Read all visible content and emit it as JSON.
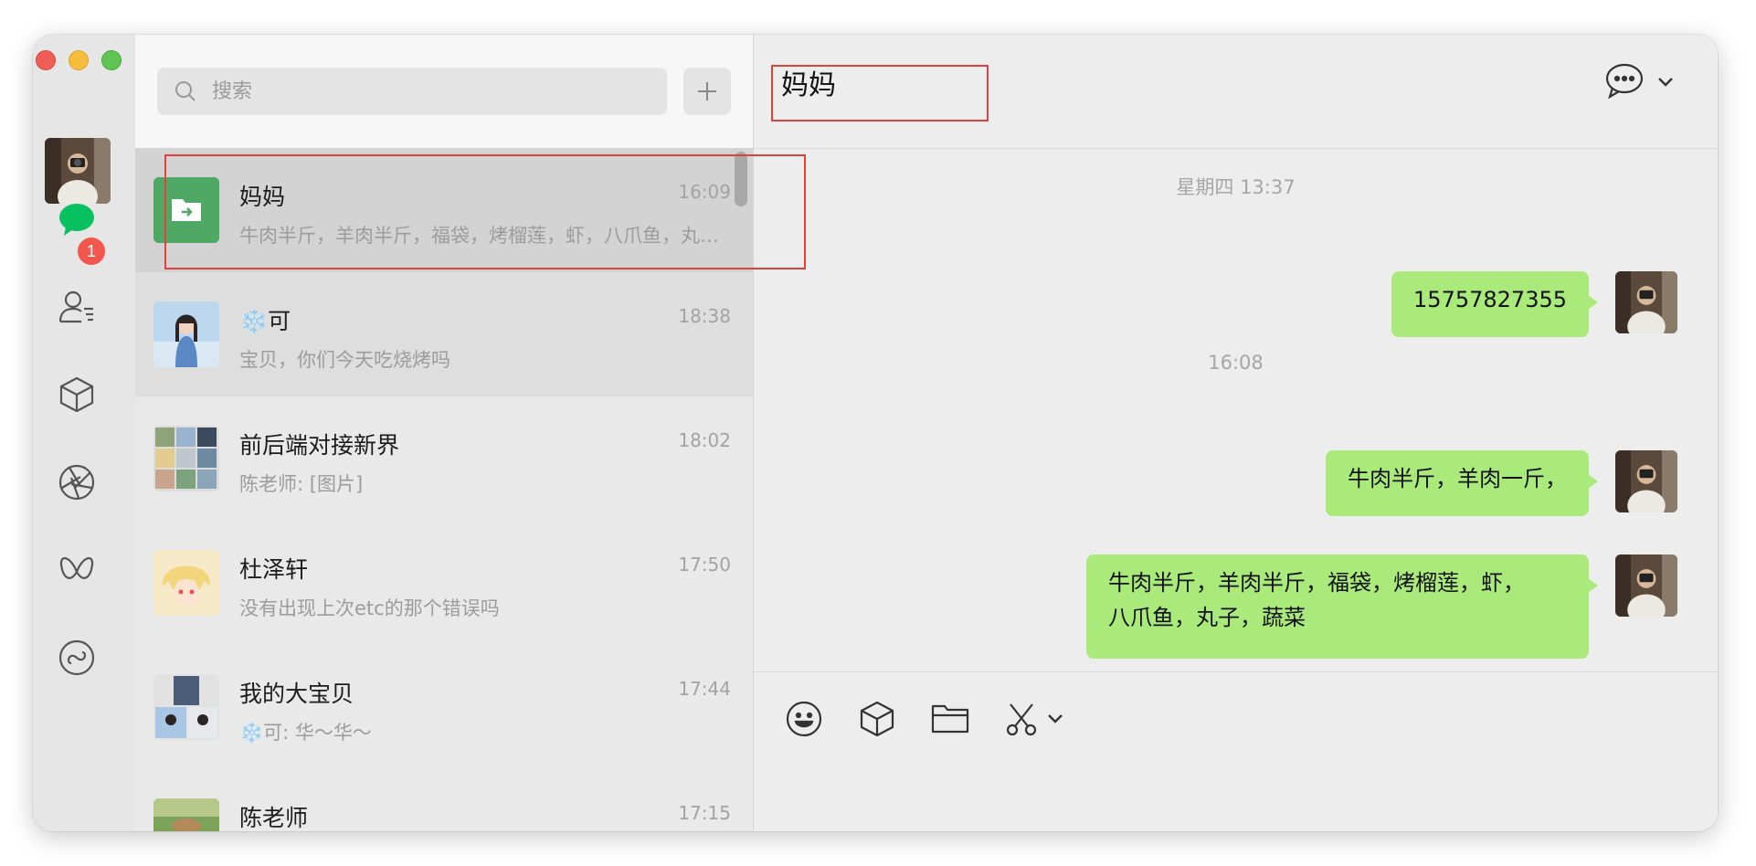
{
  "window": {
    "controls": [
      "close",
      "minimize",
      "zoom"
    ]
  },
  "nav": {
    "items": [
      {
        "name": "chats",
        "icon": "chat-bubble-icon",
        "badge": "1",
        "color": "#07c160"
      },
      {
        "name": "contacts",
        "icon": "contacts-icon"
      },
      {
        "name": "favorites",
        "icon": "cube-icon"
      },
      {
        "name": "moments",
        "icon": "aperture-icon"
      },
      {
        "name": "channels",
        "icon": "butterfly-icon"
      },
      {
        "name": "mini-programs",
        "icon": "link-circle-icon"
      }
    ]
  },
  "search": {
    "placeholder": "搜索"
  },
  "chat_list": [
    {
      "name": "妈妈",
      "time": "16:09",
      "preview": "牛肉半斤，羊肉半斤，福袋，烤榴莲，虾，八爪鱼，丸子，蔬菜",
      "avatar": "file-transfer-icon",
      "selected": true
    },
    {
      "name": "❄️可",
      "time": "18:38",
      "preview": "宝贝，你们今天吃烧烤吗",
      "pinned": true
    },
    {
      "name": "前后端对接新界",
      "time": "18:02",
      "preview": "陈老师: [图片]"
    },
    {
      "name": "杜泽轩",
      "time": "17:50",
      "preview": "没有出现上次etc的那个错误吗"
    },
    {
      "name": "我的大宝贝",
      "time": "17:44",
      "preview": "❄️可: 华～华～"
    },
    {
      "name": "陈老师",
      "time": "17:15",
      "preview": ""
    }
  ],
  "conversation": {
    "title": "妈妈",
    "timestamps": [
      "星期四 13:37",
      "16:08"
    ],
    "messages": [
      {
        "text": "15757827355"
      },
      {
        "text": "牛肉半斤，羊肉一斤，"
      },
      {
        "line1": "牛肉半斤，羊肉半斤，福袋，烤榴莲，虾，",
        "line2": "八爪鱼，丸子，蔬菜"
      }
    ]
  },
  "composer": {
    "tools": [
      "emoji-icon",
      "cube-icon",
      "folder-icon",
      "scissors-icon"
    ]
  },
  "colors": {
    "bubble": "#a9ea7a",
    "accent": "#07c160",
    "badge": "#f2564c",
    "highlight_box": "#e0413a"
  }
}
